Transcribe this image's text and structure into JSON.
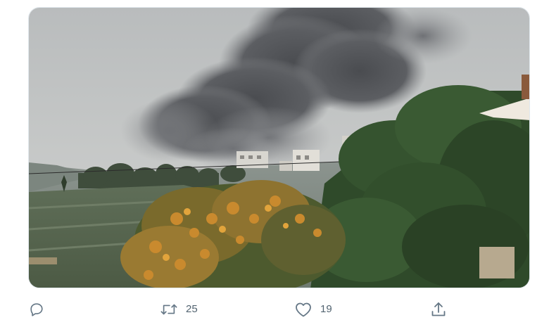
{
  "tweet": {
    "media": {
      "kind": "photo",
      "subject": "smoke-plume-over-hillside"
    },
    "actions": {
      "reply": {
        "icon": "reply-icon"
      },
      "retweet": {
        "icon": "retweet-icon",
        "count": "25"
      },
      "like": {
        "icon": "heart-icon",
        "count": "19"
      },
      "share": {
        "icon": "share-icon"
      }
    }
  },
  "colors": {
    "action_gray": "#657786",
    "card_border": "#e1e8ed",
    "background": "#ffffff"
  }
}
